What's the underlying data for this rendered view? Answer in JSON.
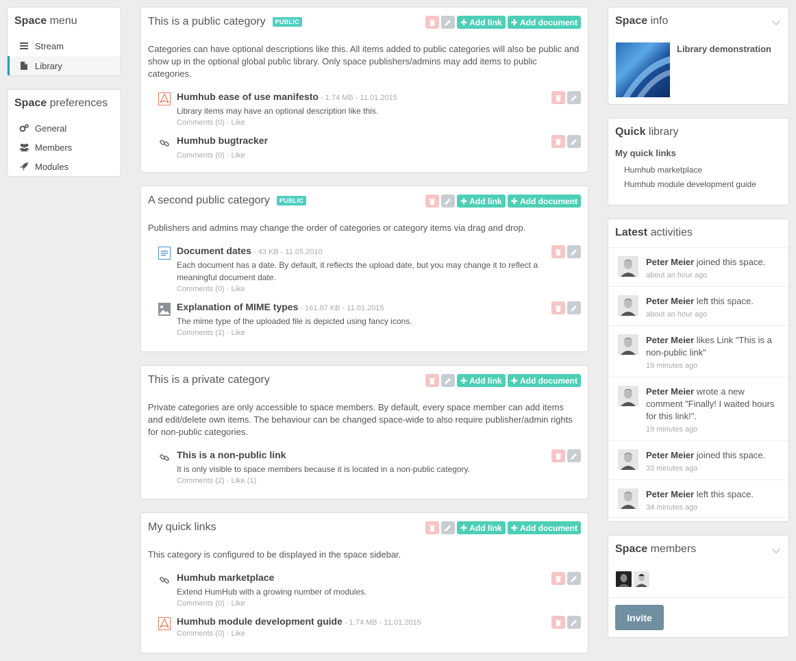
{
  "space_menu": {
    "title_bold": "Space",
    "title_rest": "menu",
    "items": [
      {
        "label": "Stream",
        "icon": "bars-icon"
      },
      {
        "label": "Library",
        "icon": "file-icon"
      }
    ]
  },
  "space_prefs": {
    "title_bold": "Space",
    "title_rest": "preferences",
    "items": [
      {
        "label": "General",
        "icon": "gears-icon"
      },
      {
        "label": "Members",
        "icon": "users-icon"
      },
      {
        "label": "Modules",
        "icon": "rocket-icon"
      }
    ]
  },
  "actions": {
    "add_link": "Add link",
    "add_document": "Add document"
  },
  "categories": [
    {
      "title": "This is a public category",
      "badge": "PUBLIC",
      "description": "Categories can have optional descriptions like this. All items added to public categories will also be public and show up in the optional global public library. Only space publishers/admins may add items to public categories.",
      "items": [
        {
          "icon": "pdf-icon",
          "title": "Humhub ease of use manifesto",
          "meta": " - 1.74 MB - 11.01.2015",
          "desc": "Library items may have an optional description like this.",
          "comments": "Comments (0)",
          "like": "Like"
        },
        {
          "icon": "link-icon",
          "title": "Humhub bugtracker",
          "meta": "",
          "desc": "",
          "comments": "Comments (0)",
          "like": "Like"
        }
      ]
    },
    {
      "title": "A second public category",
      "badge": "PUBLIC",
      "description": "Publishers and admins may change the order of categories or category items via drag and drop.",
      "items": [
        {
          "icon": "document-icon",
          "title": "Document dates",
          "meta": " - 43 KB - 11.05.2010",
          "desc": "Each document has a date. By default, it reflects the upload date, but you may change it to reflect a meaningful document date.",
          "comments": "Comments (0)",
          "like": "Like"
        },
        {
          "icon": "image-icon",
          "title": "Explanation of MIME types",
          "meta": " - 161.87 KB - 11.01.2015",
          "desc": "The mime type of the uploaded file is depicted using fancy icons.",
          "comments": "Comments (1)",
          "like": "Like"
        }
      ]
    },
    {
      "title": "This is a private category",
      "badge": "",
      "description": "Private categories are only accessible to space members. By default, every space member can add items and edit/delete own items. The behaviour can be changed space-wide to also require publisher/admin rights for non-public categories.",
      "items": [
        {
          "icon": "link-icon",
          "title": "This is a non-public link",
          "meta": "",
          "desc": "It is only visible to space members because it is located in a non-public category.",
          "comments": "Comments (2)",
          "like": "Like (1)"
        }
      ]
    },
    {
      "title": "My quick links",
      "badge": "",
      "description": "This category is configured to be displayed in the space sidebar.",
      "items": [
        {
          "icon": "link-icon",
          "title": "Humhub marketplace",
          "meta": "",
          "desc": "Extend HumHub with a growing number of modules.",
          "comments": "Comments (0)",
          "like": "Like"
        },
        {
          "icon": "pdf-icon",
          "title": "Humhub module development guide",
          "meta": " - 1.74 MB - 11.01.2015",
          "desc": "",
          "comments": "Comments (0)",
          "like": "Like"
        }
      ]
    }
  ],
  "space_info": {
    "title_bold": "Space",
    "title_rest": "info",
    "name": "Library demonstration"
  },
  "quick_library": {
    "title_bold": "Quick",
    "title_rest": "library",
    "heading": "My quick links",
    "links": [
      "Humhub marketplace",
      "Humhub module development guide"
    ]
  },
  "latest": {
    "title_bold": "Latest",
    "title_rest": "activities",
    "items": [
      {
        "user": "Peter Meier",
        "text": " joined this space.",
        "time": "about an hour ago"
      },
      {
        "user": "Peter Meier",
        "text": " left this space.",
        "time": "about an hour ago"
      },
      {
        "user": "Peter Meier",
        "text": " likes Link \"This is a non-public link\"",
        "time": "19 minutes ago"
      },
      {
        "user": "Peter Meier",
        "text": " wrote a new comment \"Finally! I waited hours for this link!\".",
        "time": "19 minutes ago"
      },
      {
        "user": "Peter Meier",
        "text": " joined this space.",
        "time": "33 minutes ago"
      },
      {
        "user": "Peter Meier",
        "text": " left this space.",
        "time": "34 minutes ago"
      }
    ]
  },
  "members": {
    "title_bold": "Space",
    "title_rest": "members",
    "invite": "Invite"
  },
  "colors": {
    "accent": "#21a1b3",
    "green": "#4dcfb6",
    "danger_light": "#f7c5c5",
    "invite": "#708fa0"
  }
}
